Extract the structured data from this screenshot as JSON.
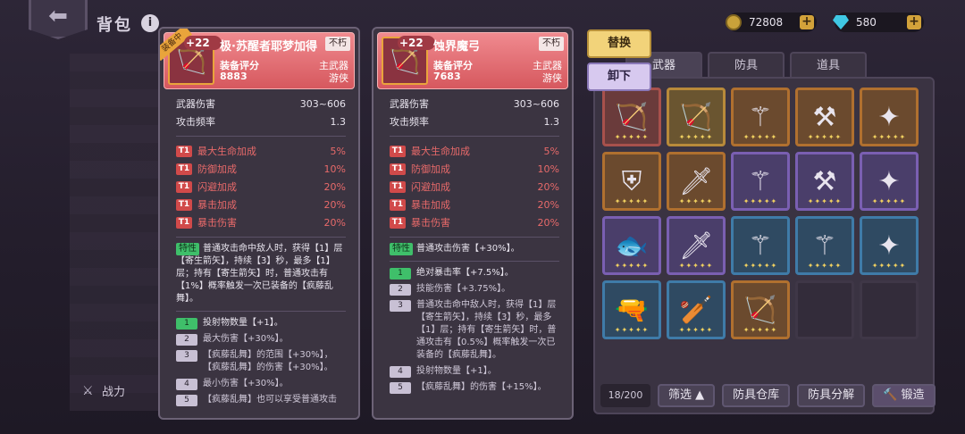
{
  "header": {
    "title": "背包",
    "info_icon": "i"
  },
  "currency": {
    "coins": "72808",
    "gems": "580",
    "plus": "+"
  },
  "power_label": "战力",
  "actions": {
    "swap": "替换",
    "unequip": "卸下"
  },
  "tabs": [
    {
      "label": "武器"
    },
    {
      "label": "防具"
    },
    {
      "label": "道具"
    }
  ],
  "inventory": {
    "count": "18/200",
    "filter": "筛选 ▲",
    "buttons": {
      "warehouse": "防具仓库",
      "decompose": "防具分解",
      "forge": "锻造"
    }
  },
  "card_left": {
    "equipped_tag": "装备中",
    "level": "+22",
    "name": "极·苏醒者耶梦加得",
    "badge": "不朽",
    "score_label": "装备评分",
    "score": "8883",
    "type1": "主武器",
    "type2": "游侠",
    "stats": [
      {
        "name": "武器伤害",
        "value": "303~606"
      },
      {
        "name": "攻击频率",
        "value": "1.3"
      }
    ],
    "bonuses": [
      {
        "tag": "T1",
        "name": "最大生命加成",
        "value": "5%"
      },
      {
        "tag": "T1",
        "name": "防御加成",
        "value": "10%"
      },
      {
        "tag": "T1",
        "name": "闪避加成",
        "value": "20%"
      },
      {
        "tag": "T1",
        "name": "暴击加成",
        "value": "20%"
      },
      {
        "tag": "T1",
        "name": "暴击伤害",
        "value": "20%"
      }
    ],
    "trait_tag": "特性",
    "trait": "普通攻击命中敌人时，获得【1】层【寄生箭矢】，持续【3】秒，最多【1】层；持有【寄生箭矢】时，普通攻击有【1%】概率触发一次已装备的【疯藤乱舞】。",
    "affixes": [
      {
        "num": "1",
        "text": "投射物数量【+1】。",
        "on": true
      },
      {
        "num": "2",
        "text": "最大伤害【+30%】。",
        "on": false
      },
      {
        "num": "3",
        "text": "【疯藤乱舞】的范围【+30%】，【疯藤乱舞】的伤害【+30%】。",
        "on": false
      },
      {
        "num": "4",
        "text": "最小伤害【+30%】。",
        "on": false
      },
      {
        "num": "5",
        "text": "【疯藤乱舞】也可以享受普通攻击",
        "on": false
      }
    ]
  },
  "card_right": {
    "level": "+22",
    "name": "蚀界魔弓",
    "badge": "不朽",
    "score_label": "装备评分",
    "score": "7683",
    "type1": "主武器",
    "type2": "游侠",
    "stats": [
      {
        "name": "武器伤害",
        "value": "303~606"
      },
      {
        "name": "攻击频率",
        "value": "1.3"
      }
    ],
    "bonuses": [
      {
        "tag": "T1",
        "name": "最大生命加成",
        "value": "5%"
      },
      {
        "tag": "T1",
        "name": "防御加成",
        "value": "10%"
      },
      {
        "tag": "T1",
        "name": "闪避加成",
        "value": "20%"
      },
      {
        "tag": "T1",
        "name": "暴击加成",
        "value": "20%"
      },
      {
        "tag": "T1",
        "name": "暴击伤害",
        "value": "20%"
      }
    ],
    "trait_tag": "特性",
    "trait": "普通攻击伤害【+30%】。",
    "affixes": [
      {
        "num": "1",
        "text": "绝对暴击率【+7.5%】。",
        "on": true
      },
      {
        "num": "2",
        "text": "技能伤害【+3.75%】。",
        "on": false
      },
      {
        "num": "3",
        "text": "普通攻击命中敌人时，获得【1】层【寄生箭矢】，持续【3】秒，最多【1】层；持有【寄生箭矢】时，普通攻击有【0.5%】概率触发一次已装备的【疯藤乱舞】。",
        "on": false
      },
      {
        "num": "4",
        "text": "投射物数量【+1】。",
        "on": false
      },
      {
        "num": "5",
        "text": "【疯藤乱舞】的伤害【+15%】。",
        "on": false
      }
    ]
  },
  "slots": [
    {
      "rarity": "red",
      "icon": "bow-icon"
    },
    {
      "rarity": "gold",
      "icon": "bow-icon"
    },
    {
      "rarity": "orange",
      "icon": "staff-icon"
    },
    {
      "rarity": "orange",
      "icon": "axe-icon"
    },
    {
      "rarity": "orange",
      "icon": "shuriken-icon"
    },
    {
      "rarity": "orange",
      "icon": "shield-icon"
    },
    {
      "rarity": "orange",
      "icon": "blade-icon"
    },
    {
      "rarity": "purple",
      "icon": "staff-icon"
    },
    {
      "rarity": "purple",
      "icon": "axe-icon"
    },
    {
      "rarity": "purple",
      "icon": "shuriken-icon"
    },
    {
      "rarity": "purple",
      "icon": "fish-icon"
    },
    {
      "rarity": "purple",
      "icon": "blade-icon"
    },
    {
      "rarity": "blue",
      "icon": "staff-icon"
    },
    {
      "rarity": "blue",
      "icon": "staff-icon"
    },
    {
      "rarity": "blue",
      "icon": "shuriken-icon"
    },
    {
      "rarity": "blue",
      "icon": "gun-icon"
    },
    {
      "rarity": "blue",
      "icon": "club-icon"
    },
    {
      "rarity": "orange",
      "icon": "bow-icon"
    },
    {
      "rarity": "empty",
      "icon": ""
    },
    {
      "rarity": "empty",
      "icon": ""
    }
  ]
}
